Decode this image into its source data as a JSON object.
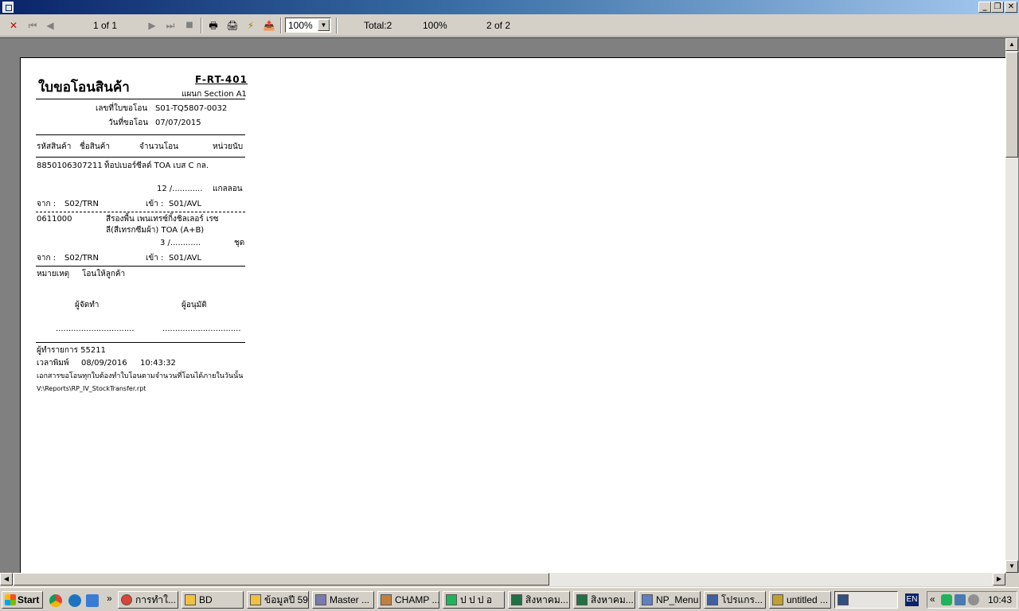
{
  "toolbar": {
    "page_indicator": "1 of 1",
    "zoom": "100%",
    "total": "Total:2",
    "percent": "100%",
    "records": "2 of 2"
  },
  "report": {
    "title": "ใบขอโอนสินค้า",
    "code": "F-RT-401",
    "department": "แผนก Section A1",
    "doc_no_label": "เลขที่ใบขอโอน",
    "doc_no": "S01-TQ5807-0032",
    "date_label": "วันที่ขอโอน",
    "date": "07/07/2015",
    "columns": [
      "รหัสสินค้า",
      "ชื่อสินค้า",
      "จำนวนโอน",
      "หน่วยนับ"
    ],
    "items": [
      {
        "code": "8850106307211",
        "name": "ท็อปเบอร์ซีลด์ TOA เบส C กล.",
        "name2": "",
        "qty": "12 /............",
        "unit": "แกลลอน",
        "from_label": "จาก :",
        "from": "S02/TRN",
        "to_label": "เข้า :",
        "to": "S01/AVL"
      },
      {
        "code": "0611000",
        "name": "สีรองพื้น เพนเทรซ์กิ้งชิลเลอร์ เรซ",
        "name2": "ลี(สีเทรกซีมผ้า) TOA (A+B)",
        "qty": "3 /............",
        "unit": "ชุด",
        "from_label": "จาก :",
        "from": "S02/TRN",
        "to_label": "เข้า :",
        "to": "S01/AVL"
      }
    ],
    "remark_label": "หมายเหตุ",
    "remark": "โอนให้ลูกค้า",
    "preparer_label": "ผู้จัดทำ",
    "approver_label": "ผู้อนุมัติ",
    "signature_line": "...............................",
    "operator": "ผู้ทำรายการ 55211",
    "print_time_label": "เวลาพิมพ์",
    "print_date": "08/09/2016",
    "print_time": "10:43:32",
    "note": "เอกสารขอโอนทุกใบต้องทำใบโอนตามจำนวนที่โอนได้ภายในวันนั้น",
    "path": "V:\\Reports\\RP_IV_StockTransfer.rpt"
  },
  "taskbar": {
    "start": "Start",
    "tasks": [
      {
        "label": "การทำใ...",
        "color": "#db4437"
      },
      {
        "label": "BD",
        "color": "#f0c040"
      },
      {
        "label": "ข้อมูลปี 59",
        "color": "#f0c040"
      },
      {
        "label": "Master ...",
        "color": "#7a7ab0"
      },
      {
        "label": "CHAMP ...",
        "color": "#c08040"
      },
      {
        "label": "ป ป ป อ",
        "color": "#1fb35b"
      },
      {
        "label": "สิงหาคม...",
        "color": "#207245"
      },
      {
        "label": "สิงหาคม...",
        "color": "#207245"
      },
      {
        "label": "NP_Menu",
        "color": "#6080c0"
      },
      {
        "label": "โปรแกร...",
        "color": "#4060a0"
      },
      {
        "label": "untitled ...",
        "color": "#c0a030"
      },
      {
        "label": "",
        "color": "#305080"
      }
    ],
    "lang": "EN",
    "clock": "10:43"
  },
  "colors": {
    "titlebar_start": "#0a246a",
    "titlebar_end": "#a6caf0",
    "face": "#d4d0c8",
    "viewer_bg": "#808080",
    "close_red": "#c00000"
  }
}
